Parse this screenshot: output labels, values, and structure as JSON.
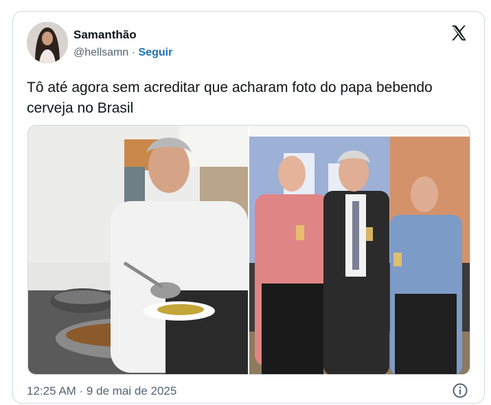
{
  "author": {
    "name": "Samanthão",
    "handle": "@hellsamn",
    "separator": " · ",
    "follow_label": "Seguir",
    "avatar_icon": "profile-photo"
  },
  "tweet": {
    "text": "Tô até agora sem acreditar que acharam foto do papa bebendo cerveja no Brasil",
    "timestamp": "12:25 AM · 9 de mai de 2025"
  },
  "media": [
    {
      "name": "photo-priest-serving-food"
    },
    {
      "name": "photo-men-toasting"
    }
  ],
  "icons": {
    "platform": "x-logo-icon",
    "info": "info-icon"
  },
  "colors": {
    "link": "#1d72b8",
    "text": "#0f1419",
    "muted": "#536471",
    "border": "#cfd9de"
  }
}
